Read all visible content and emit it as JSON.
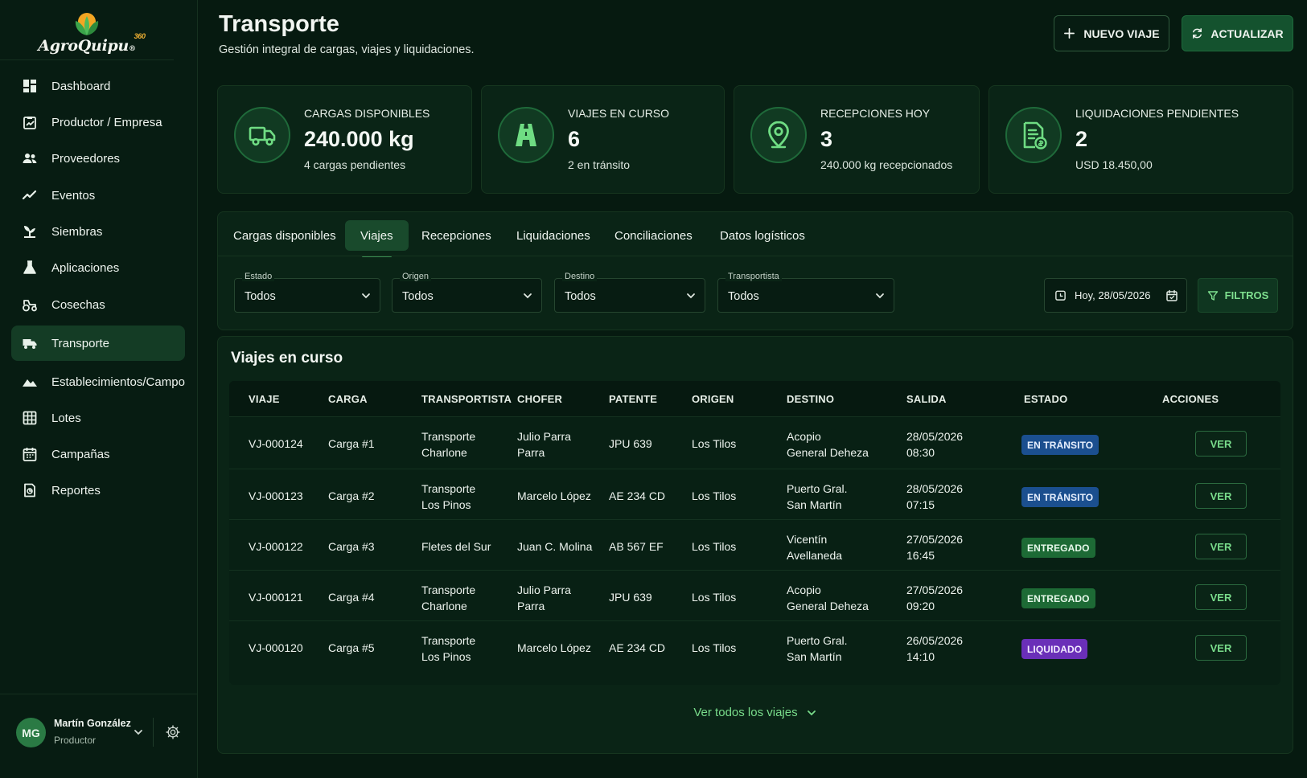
{
  "brand": {
    "name": "AgroQuipu",
    "suffix": "360",
    "registered": "®"
  },
  "sidebar": {
    "items": [
      {
        "label": "Dashboard",
        "icon": "dashboard-icon"
      },
      {
        "label": "Productor / Empresa",
        "icon": "clipboard-icon"
      },
      {
        "label": "Proveedores",
        "icon": "users-icon"
      },
      {
        "label": "Eventos",
        "icon": "trend-line-icon"
      },
      {
        "label": "Siembras",
        "icon": "sprout-icon"
      },
      {
        "label": "Aplicaciones",
        "icon": "flask-icon"
      },
      {
        "label": "Cosechas",
        "icon": "tractor-icon"
      },
      {
        "label": "Transporte",
        "icon": "truck-icon",
        "active": true
      },
      {
        "label": "Establecimientos/Campo",
        "icon": "landscape-icon"
      },
      {
        "label": "Lotes",
        "icon": "grid-icon"
      },
      {
        "label": "Campañas",
        "icon": "calendar-icon"
      },
      {
        "label": "Reportes",
        "icon": "report-icon"
      }
    ]
  },
  "user": {
    "initials": "MG",
    "name": "Martín González",
    "role": "Productor"
  },
  "header": {
    "title": "Transporte",
    "subtitle": "Gestión integral de cargas, viajes y liquidaciones.",
    "new_trip_label": "NUEVO VIAJE",
    "refresh_label": "ACTUALIZAR"
  },
  "kpis": [
    {
      "label": "CARGAS DISPONIBLES",
      "value": "240.000 kg",
      "sub": "4 cargas pendientes",
      "icon": "truck-icon"
    },
    {
      "label": "VIAJES EN CURSO",
      "value": "6",
      "sub": "2 en tránsito",
      "icon": "road-icon"
    },
    {
      "label": "RECEPCIONES HOY",
      "value": "3",
      "sub": "240.000 kg recepcionados",
      "icon": "map-pin-icon"
    },
    {
      "label": "LIQUIDACIONES PENDIENTES",
      "value": "2",
      "sub": "USD 18.450,00",
      "icon": "invoice-icon"
    }
  ],
  "tabs": [
    {
      "label": "Cargas disponibles"
    },
    {
      "label": "Viajes",
      "active": true
    },
    {
      "label": "Recepciones"
    },
    {
      "label": "Liquidaciones"
    },
    {
      "label": "Conciliaciones"
    },
    {
      "label": "Datos logísticos"
    }
  ],
  "filters": {
    "estado": {
      "legend": "Estado",
      "value": "Todos"
    },
    "origen": {
      "legend": "Origen",
      "value": "Todos"
    },
    "destino": {
      "legend": "Destino",
      "value": "Todos"
    },
    "transportista": {
      "legend": "Transportista",
      "value": "Todos"
    },
    "date": "Hoy, 28/05/2026",
    "filters_label": "FILTROS"
  },
  "table": {
    "title": "Viajes en curso",
    "columns": [
      "VIAJE",
      "CARGA",
      "TRANSPORTISTA",
      "CHOFER",
      "PATENTE",
      "ORIGEN",
      "DESTINO",
      "SALIDA",
      "ESTADO",
      "ACCIONES"
    ],
    "rows": [
      {
        "viaje": "VJ-000124",
        "carga": "Carga #1",
        "transportista": [
          "Transporte",
          "Charlone"
        ],
        "chofer": [
          "Julio Parra",
          "Parra"
        ],
        "patente": "JPU 639",
        "origen": "Los Tilos",
        "destino": [
          "Acopio",
          "General Deheza"
        ],
        "salida": [
          "28/05/2026",
          "08:30"
        ],
        "estado": "EN TRÁNSITO",
        "estado_kind": "transit",
        "accion": "VER"
      },
      {
        "viaje": "VJ-000123",
        "carga": "Carga #2",
        "transportista": [
          "Transporte",
          "Los Pinos"
        ],
        "chofer": [
          "Marcelo López"
        ],
        "patente": "AE 234 CD",
        "origen": "Los Tilos",
        "destino": [
          "Puerto Gral.",
          "San Martín"
        ],
        "salida": [
          "28/05/2026",
          "07:15"
        ],
        "estado": "EN TRÁNSITO",
        "estado_kind": "transit",
        "accion": "VER"
      },
      {
        "viaje": "VJ-000122",
        "carga": "Carga #3",
        "transportista": [
          "Fletes del Sur"
        ],
        "chofer": [
          "Juan C. Molina"
        ],
        "patente": "AB 567 EF",
        "origen": "Los Tilos",
        "destino": [
          "Vicentín",
          "Avellaneda"
        ],
        "salida": [
          "27/05/2026",
          "16:45"
        ],
        "estado": "ENTREGADO",
        "estado_kind": "delivered",
        "accion": "VER"
      },
      {
        "viaje": "VJ-000121",
        "carga": "Carga #4",
        "transportista": [
          "Transporte",
          "Charlone"
        ],
        "chofer": [
          "Julio Parra",
          "Parra"
        ],
        "patente": "JPU 639",
        "origen": "Los Tilos",
        "destino": [
          "Acopio",
          "General Deheza"
        ],
        "salida": [
          "27/05/2026",
          "09:20"
        ],
        "estado": "ENTREGADO",
        "estado_kind": "delivered",
        "accion": "VER"
      },
      {
        "viaje": "VJ-000120",
        "carga": "Carga #5",
        "transportista": [
          "Transporte",
          "Los Pinos"
        ],
        "chofer": [
          "Marcelo López"
        ],
        "patente": "AE 234 CD",
        "origen": "Los Tilos",
        "destino": [
          "Puerto Gral.",
          "San Martín"
        ],
        "salida": [
          "26/05/2026",
          "14:10"
        ],
        "estado": "LIQUIDADO",
        "estado_kind": "settled",
        "accion": "VER"
      }
    ],
    "see_all": "Ver todos los viajes"
  },
  "colors": {
    "background": "#061a10",
    "panel": "#0a2416",
    "accent": "#79dc8b",
    "badge_transit": "#1b4f8f",
    "badge_delivered": "#1d6a35",
    "badge_settled": "#6a2fb8"
  }
}
